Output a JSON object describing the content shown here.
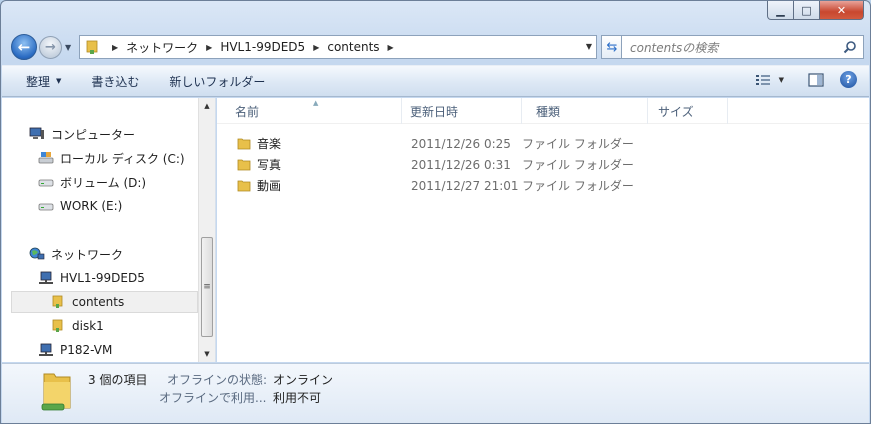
{
  "caption": {
    "min": "▁",
    "max": "□",
    "close": "✕"
  },
  "nav": {
    "back_glyph": "←",
    "forward_glyph": "→",
    "breadcrumb": [
      "ネットワーク",
      "HVL1-99DED5",
      "contents"
    ],
    "search_placeholder": "contentsの検索"
  },
  "commands": [
    {
      "label": "整理",
      "has_dropdown": true
    },
    {
      "label": "書き込む",
      "has_dropdown": false
    },
    {
      "label": "新しいフォルダー",
      "has_dropdown": false
    }
  ],
  "help_glyph": "?",
  "sidebar": {
    "items": [
      {
        "label": "コンピューター",
        "icon": "computer-icon"
      },
      {
        "label": "ローカル ディスク (C:)",
        "icon": "local-disk-icon"
      },
      {
        "label": "ボリューム (D:)",
        "icon": "drive-icon"
      },
      {
        "label": "WORK (E:)",
        "icon": "drive-icon"
      },
      {
        "label": "ネットワーク",
        "icon": "network-icon"
      },
      {
        "label": "HVL1-99DED5",
        "icon": "network-computer-icon"
      },
      {
        "label": "contents",
        "icon": "shared-folder-icon",
        "selected": true
      },
      {
        "label": "disk1",
        "icon": "shared-folder-icon"
      },
      {
        "label": "P182-VM",
        "icon": "network-computer-icon"
      }
    ]
  },
  "columns": [
    "名前",
    "更新日時",
    "種類",
    "サイズ"
  ],
  "files": [
    {
      "name": "音楽",
      "date": "2011/12/26 0:25",
      "type": "ファイル フォルダー"
    },
    {
      "name": "写真",
      "date": "2011/12/26 0:31",
      "type": "ファイル フォルダー"
    },
    {
      "name": "動画",
      "date": "2011/12/27 21:01",
      "type": "ファイル フォルダー"
    }
  ],
  "details": {
    "count": "3 個の項目",
    "offline_status_label": "オフラインの状態:",
    "offline_status_value": "オンライン",
    "offline_use_label": "オフラインで利用...",
    "offline_use_value": "利用不可"
  },
  "colors": {
    "folder": "#e8c04a",
    "accent": "#2a6bc2"
  }
}
